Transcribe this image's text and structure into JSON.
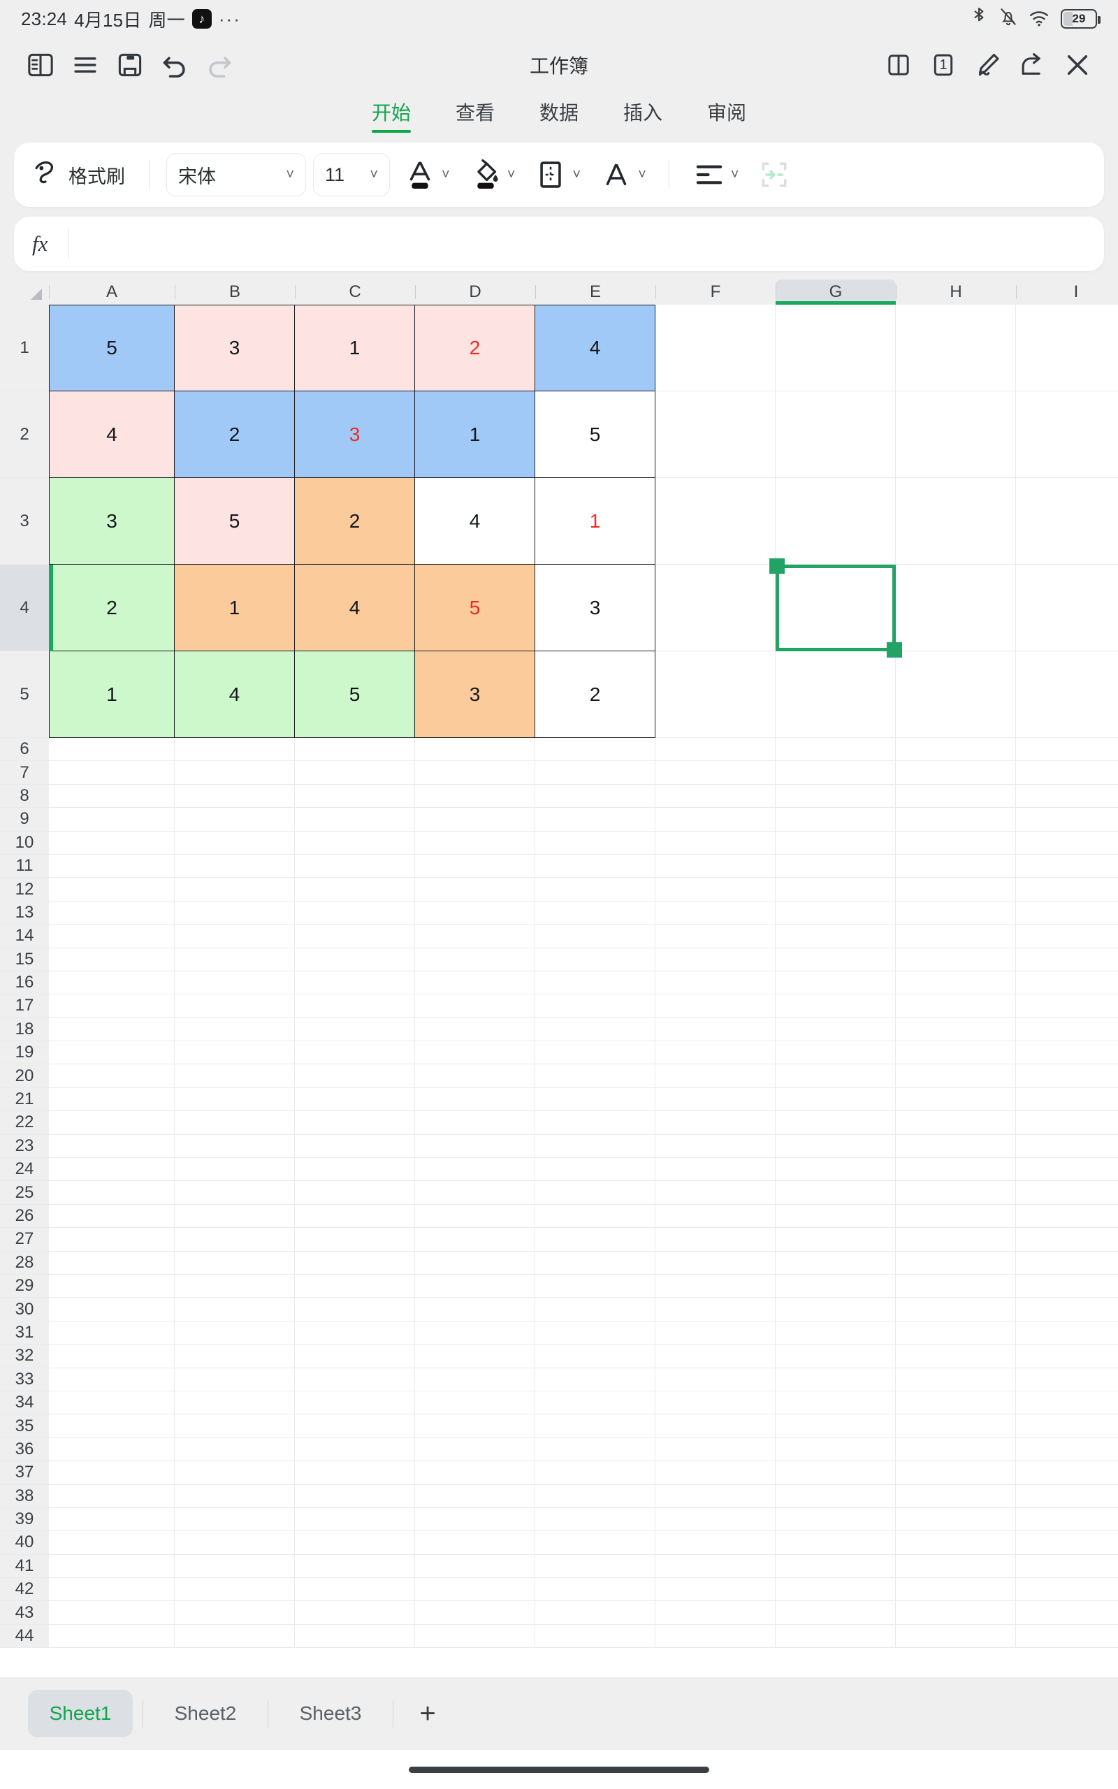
{
  "statusbar": {
    "time": "23:24",
    "date": "4月15日",
    "weekday": "周一",
    "app_badge_icon": "tiktok-icon",
    "overflow": "···",
    "icons": [
      "bluetooth-icon",
      "mute-bell-icon",
      "wifi-icon"
    ],
    "battery_level": "29"
  },
  "appbar": {
    "title": "工作簿",
    "left_icons": [
      "sidebar-toggle-icon",
      "menu-icon",
      "save-icon",
      "undo-icon",
      "redo-icon"
    ],
    "right_icons": [
      "split-view-icon",
      "page-count-icon",
      "edit-pen-icon",
      "share-icon",
      "close-icon"
    ],
    "page_count": "1"
  },
  "ribbon": {
    "tabs": [
      {
        "label": "开始",
        "active": true
      },
      {
        "label": "查看",
        "active": false
      },
      {
        "label": "数据",
        "active": false
      },
      {
        "label": "插入",
        "active": false
      },
      {
        "label": "审阅",
        "active": false
      }
    ]
  },
  "toolbar": {
    "format_painter_label": "格式刷",
    "font_name": "宋体",
    "font_size": "11",
    "font_color_icon": "font-color-icon",
    "fill_color_icon": "fill-color-icon",
    "borders_icon": "borders-icon",
    "text_style_icon": "text-style-icon",
    "align_icon": "align-icon",
    "merge_icon": "merge-cells-icon"
  },
  "formula_bar": {
    "fx_label": "fx",
    "value": "",
    "placeholder": ""
  },
  "grid": {
    "columns": [
      "A",
      "B",
      "C",
      "D",
      "E",
      "F",
      "G",
      "H",
      "I"
    ],
    "selected_column": "G",
    "selected_row": 4,
    "selected_cell": "G4",
    "row_numbers": [
      1,
      2,
      3,
      4,
      5,
      6,
      7,
      8,
      9,
      10,
      11,
      12,
      13,
      14,
      15,
      16,
      17,
      18,
      19,
      20,
      21,
      22,
      23,
      24,
      25,
      26,
      27,
      28,
      29,
      30,
      31,
      32,
      33,
      34,
      35,
      36,
      37,
      38,
      39,
      40,
      41,
      42,
      43,
      44
    ],
    "data_rows": [
      {
        "row": 1,
        "cells": [
          {
            "col": "A",
            "value": "5",
            "fill": "#a0c9f8",
            "text": "#14171a"
          },
          {
            "col": "B",
            "value": "3",
            "fill": "#fde4e2",
            "text": "#14171a"
          },
          {
            "col": "C",
            "value": "1",
            "fill": "#fde4e2",
            "text": "#14171a"
          },
          {
            "col": "D",
            "value": "2",
            "fill": "#fde4e2",
            "text": "#ef2b1f"
          },
          {
            "col": "E",
            "value": "4",
            "fill": "#a0c9f8",
            "text": "#14171a"
          }
        ]
      },
      {
        "row": 2,
        "cells": [
          {
            "col": "A",
            "value": "4",
            "fill": "#fde4e2",
            "text": "#14171a"
          },
          {
            "col": "B",
            "value": "2",
            "fill": "#a0c9f8",
            "text": "#14171a"
          },
          {
            "col": "C",
            "value": "3",
            "fill": "#a0c9f8",
            "text": "#ef2b1f"
          },
          {
            "col": "D",
            "value": "1",
            "fill": "#a0c9f8",
            "text": "#14171a"
          },
          {
            "col": "E",
            "value": "5",
            "fill": "#ffffff",
            "text": "#14171a"
          }
        ]
      },
      {
        "row": 3,
        "cells": [
          {
            "col": "A",
            "value": "3",
            "fill": "#ccf8cc",
            "text": "#14171a"
          },
          {
            "col": "B",
            "value": "5",
            "fill": "#fde4e2",
            "text": "#14171a"
          },
          {
            "col": "C",
            "value": "2",
            "fill": "#fbcb9c",
            "text": "#14171a"
          },
          {
            "col": "D",
            "value": "4",
            "fill": "#ffffff",
            "text": "#14171a"
          },
          {
            "col": "E",
            "value": "1",
            "fill": "#ffffff",
            "text": "#ef2b1f"
          }
        ]
      },
      {
        "row": 4,
        "cells": [
          {
            "col": "A",
            "value": "2",
            "fill": "#ccf8cc",
            "text": "#14171a"
          },
          {
            "col": "B",
            "value": "1",
            "fill": "#fbcb9c",
            "text": "#14171a"
          },
          {
            "col": "C",
            "value": "4",
            "fill": "#fbcb9c",
            "text": "#14171a"
          },
          {
            "col": "D",
            "value": "5",
            "fill": "#fbcb9c",
            "text": "#ef2b1f"
          },
          {
            "col": "E",
            "value": "3",
            "fill": "#ffffff",
            "text": "#14171a"
          }
        ]
      },
      {
        "row": 5,
        "cells": [
          {
            "col": "A",
            "value": "1",
            "fill": "#ccf8cc",
            "text": "#14171a"
          },
          {
            "col": "B",
            "value": "4",
            "fill": "#ccf8cc",
            "text": "#14171a"
          },
          {
            "col": "C",
            "value": "5",
            "fill": "#ccf8cc",
            "text": "#14171a"
          },
          {
            "col": "D",
            "value": "3",
            "fill": "#fbcb9c",
            "text": "#14171a"
          },
          {
            "col": "E",
            "value": "2",
            "fill": "#ffffff",
            "text": "#14171a"
          }
        ]
      }
    ]
  },
  "sheetbar": {
    "tabs": [
      {
        "label": "Sheet1",
        "active": true
      },
      {
        "label": "Sheet2",
        "active": false
      },
      {
        "label": "Sheet3",
        "active": false
      }
    ],
    "add_label": "+"
  },
  "colors": {
    "accent_green": "#10a64a",
    "selection_green": "#20a365",
    "blue_fill": "#a0c9f8",
    "pink_fill": "#fde4e2",
    "green_fill": "#ccf8cc",
    "orange_fill": "#fbcb9c",
    "red_text": "#ef2b1f"
  }
}
